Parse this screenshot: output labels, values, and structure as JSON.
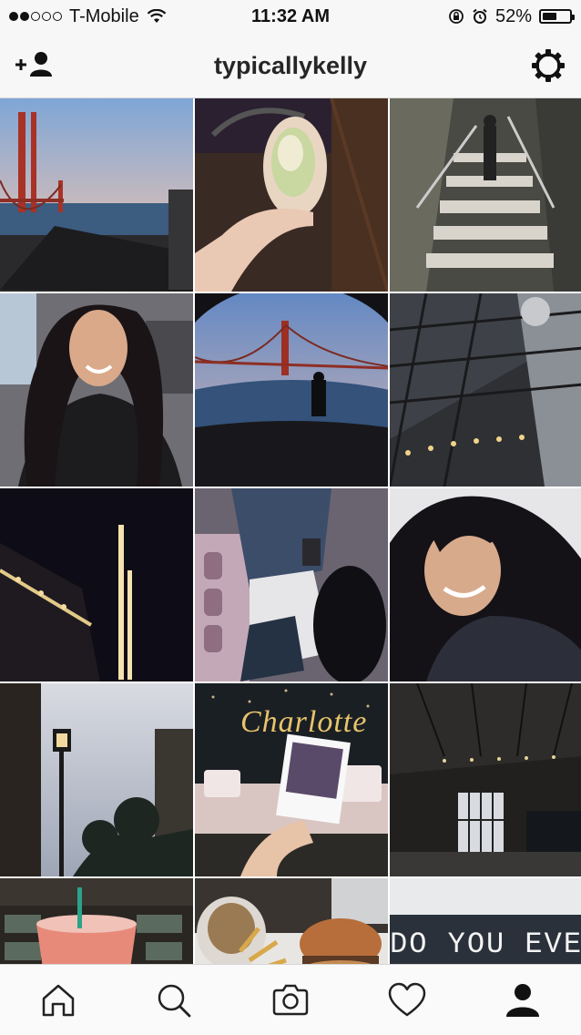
{
  "status_bar": {
    "carrier": "T-Mobile",
    "time": "11:32 AM",
    "battery_percent_text": "52%",
    "battery_level": 0.52,
    "signal_bars": 2,
    "signal_total": 5
  },
  "header": {
    "title": "typicallykelly",
    "add_user_icon": "add-person-icon",
    "settings_icon": "gear-icon"
  },
  "grid_tiles": [
    {
      "subject": "golden-gate-bridge-sunset"
    },
    {
      "subject": "burrito-in-hand"
    },
    {
      "subject": "tiled-stairway-person"
    },
    {
      "subject": "selfie-in-car"
    },
    {
      "subject": "golden-gate-fisheye-silhouette"
    },
    {
      "subject": "ferry-building-roof"
    },
    {
      "subject": "night-tower-lights"
    },
    {
      "subject": "legs-and-phone"
    },
    {
      "subject": "selfie-smiling-fisheye"
    },
    {
      "subject": "street-lamp-dusk"
    },
    {
      "subject": "dessert-table-polaroid",
      "text": "Charlotte"
    },
    {
      "subject": "industrial-hall-interior"
    },
    {
      "subject": "iced-drink-coffee-shop"
    },
    {
      "subject": "burger-and-fries"
    },
    {
      "subject": "sign-text",
      "text": "DO YOU EVEN"
    }
  ],
  "tab_bar": [
    {
      "name": "home-icon"
    },
    {
      "name": "search-icon"
    },
    {
      "name": "camera-icon"
    },
    {
      "name": "heart-icon"
    },
    {
      "name": "profile-icon",
      "active": true
    }
  ],
  "colors": {
    "bar_bg": "#f7f7f7",
    "text": "#262626",
    "accent_gold": "#e8c46a"
  }
}
